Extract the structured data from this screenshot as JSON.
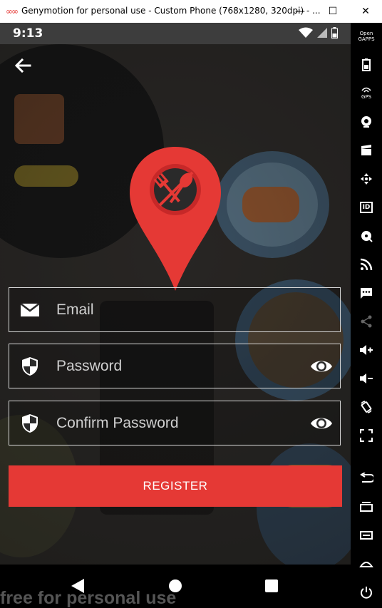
{
  "window": {
    "title": "Genymotion for personal use - Custom Phone (768x1280, 320dpi) - ...",
    "minimize": "—",
    "maximize": "☐",
    "close": "✕"
  },
  "status": {
    "time": "9:13"
  },
  "form": {
    "email_placeholder": "Email",
    "password_placeholder": "Password",
    "confirm_placeholder": "Confirm Password",
    "register_label": "REGISTER"
  },
  "watermark": "free for personal use",
  "sidebar": {
    "opengapps_line1": "Open",
    "opengapps_line2": "GAPPS",
    "gps_label": "GPS",
    "id_label": "ID"
  },
  "colors": {
    "accent": "#e53935"
  }
}
